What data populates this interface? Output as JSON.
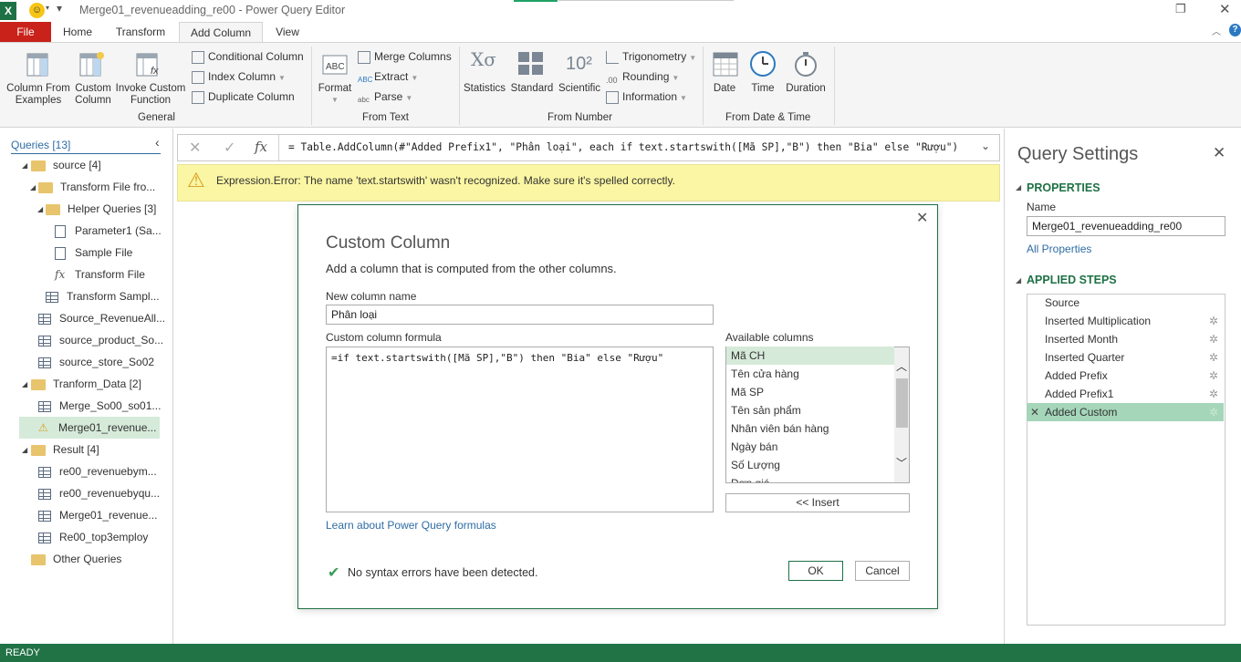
{
  "window": {
    "title": "Merge01_revenueadding_re00 - Power Query Editor"
  },
  "tabs": [
    {
      "label": "File"
    },
    {
      "label": "Home"
    },
    {
      "label": "Transform"
    },
    {
      "label": "Add Column"
    },
    {
      "label": "View"
    }
  ],
  "ribbon": {
    "general": {
      "label": "General",
      "column_from_examples": "Column From Examples",
      "custom_column": "Custom Column",
      "invoke_custom_function": "Invoke Custom Function",
      "conditional_column": "Conditional Column",
      "index_column": "Index Column",
      "duplicate_column": "Duplicate Column"
    },
    "from_text": {
      "label": "From Text",
      "format": "Format",
      "merge_columns": "Merge Columns",
      "extract": "Extract",
      "parse": "Parse"
    },
    "from_number": {
      "label": "From Number",
      "statistics": "Statistics",
      "standard": "Standard",
      "scientific": "Scientific",
      "trigonometry": "Trigonometry",
      "rounding": "Rounding",
      "information": "Information"
    },
    "from_date_time": {
      "label": "From Date & Time",
      "date": "Date",
      "time": "Time",
      "duration": "Duration"
    }
  },
  "nav": {
    "header": "Queries [13]",
    "items": [
      {
        "label": "source [4]"
      },
      {
        "label": "Transform File fro..."
      },
      {
        "label": "Helper Queries [3]"
      },
      {
        "label": "Parameter1 (Sa..."
      },
      {
        "label": "Sample File"
      },
      {
        "label": "Transform File"
      },
      {
        "label": "Transform Sampl..."
      },
      {
        "label": "Source_RevenueAll..."
      },
      {
        "label": "source_product_So..."
      },
      {
        "label": "source_store_So02"
      },
      {
        "label": "Tranform_Data [2]"
      },
      {
        "label": "Merge_So00_so01..."
      },
      {
        "label": "Merge01_revenue..."
      },
      {
        "label": "Result [4]"
      },
      {
        "label": "re00_revenuebym..."
      },
      {
        "label": "re00_revenuebyqu..."
      },
      {
        "label": "Merge01_revenue..."
      },
      {
        "label": "Re00_top3employ"
      },
      {
        "label": "Other Queries"
      }
    ]
  },
  "formula_bar": {
    "fx": "fx",
    "formula": "= Table.AddColumn(#\"Added Prefix1\", \"Phân loại\", each if text.startswith([Mã SP],\"B\") then \"Bia\" else \"Rượu\")"
  },
  "error": {
    "message": "Expression.Error: The name 'text.startswith' wasn't recognized.  Make sure it's spelled correctly."
  },
  "query_settings": {
    "title": "Query Settings",
    "properties_header": "PROPERTIES",
    "name_label": "Name",
    "name_value": "Merge01_revenueadding_re00",
    "all_properties": "All Properties",
    "applied_steps_header": "APPLIED STEPS",
    "steps": [
      {
        "label": "Source"
      },
      {
        "label": "Inserted Multiplication"
      },
      {
        "label": "Inserted Month"
      },
      {
        "label": "Inserted Quarter"
      },
      {
        "label": "Added Prefix"
      },
      {
        "label": "Added Prefix1"
      },
      {
        "label": "Added Custom"
      }
    ]
  },
  "dialog": {
    "title": "Custom Column",
    "subtitle": "Add a column that is computed from the other columns.",
    "new_column_label": "New column name",
    "new_column_value": "Phân loại",
    "formula_label": "Custom column formula",
    "formula_value": "=if text.startswith([Mã SP],\"B\") then \"Bia\" else \"Rượu\"",
    "available_label": "Available columns",
    "available_columns": [
      {
        "label": "Mã CH"
      },
      {
        "label": "Tên cửa hàng"
      },
      {
        "label": "Mã SP"
      },
      {
        "label": "Tên sản phẩm"
      },
      {
        "label": "Nhân viên bán hàng"
      },
      {
        "label": "Ngày bán"
      },
      {
        "label": "Số Lượng"
      },
      {
        "label": "Đơn giá"
      }
    ],
    "insert_button": "<< Insert",
    "learn_link": "Learn about Power Query formulas",
    "syntax_status": "No syntax errors have been detected.",
    "ok": "OK",
    "cancel": "Cancel"
  },
  "status_bar": {
    "text": "READY"
  },
  "colors": {
    "excel_green": "#217346",
    "file_red": "#c9221a",
    "selection_green": "#a5d6b9",
    "error_yellow": "#fbf6a3",
    "link_blue": "#2e6ca4"
  }
}
